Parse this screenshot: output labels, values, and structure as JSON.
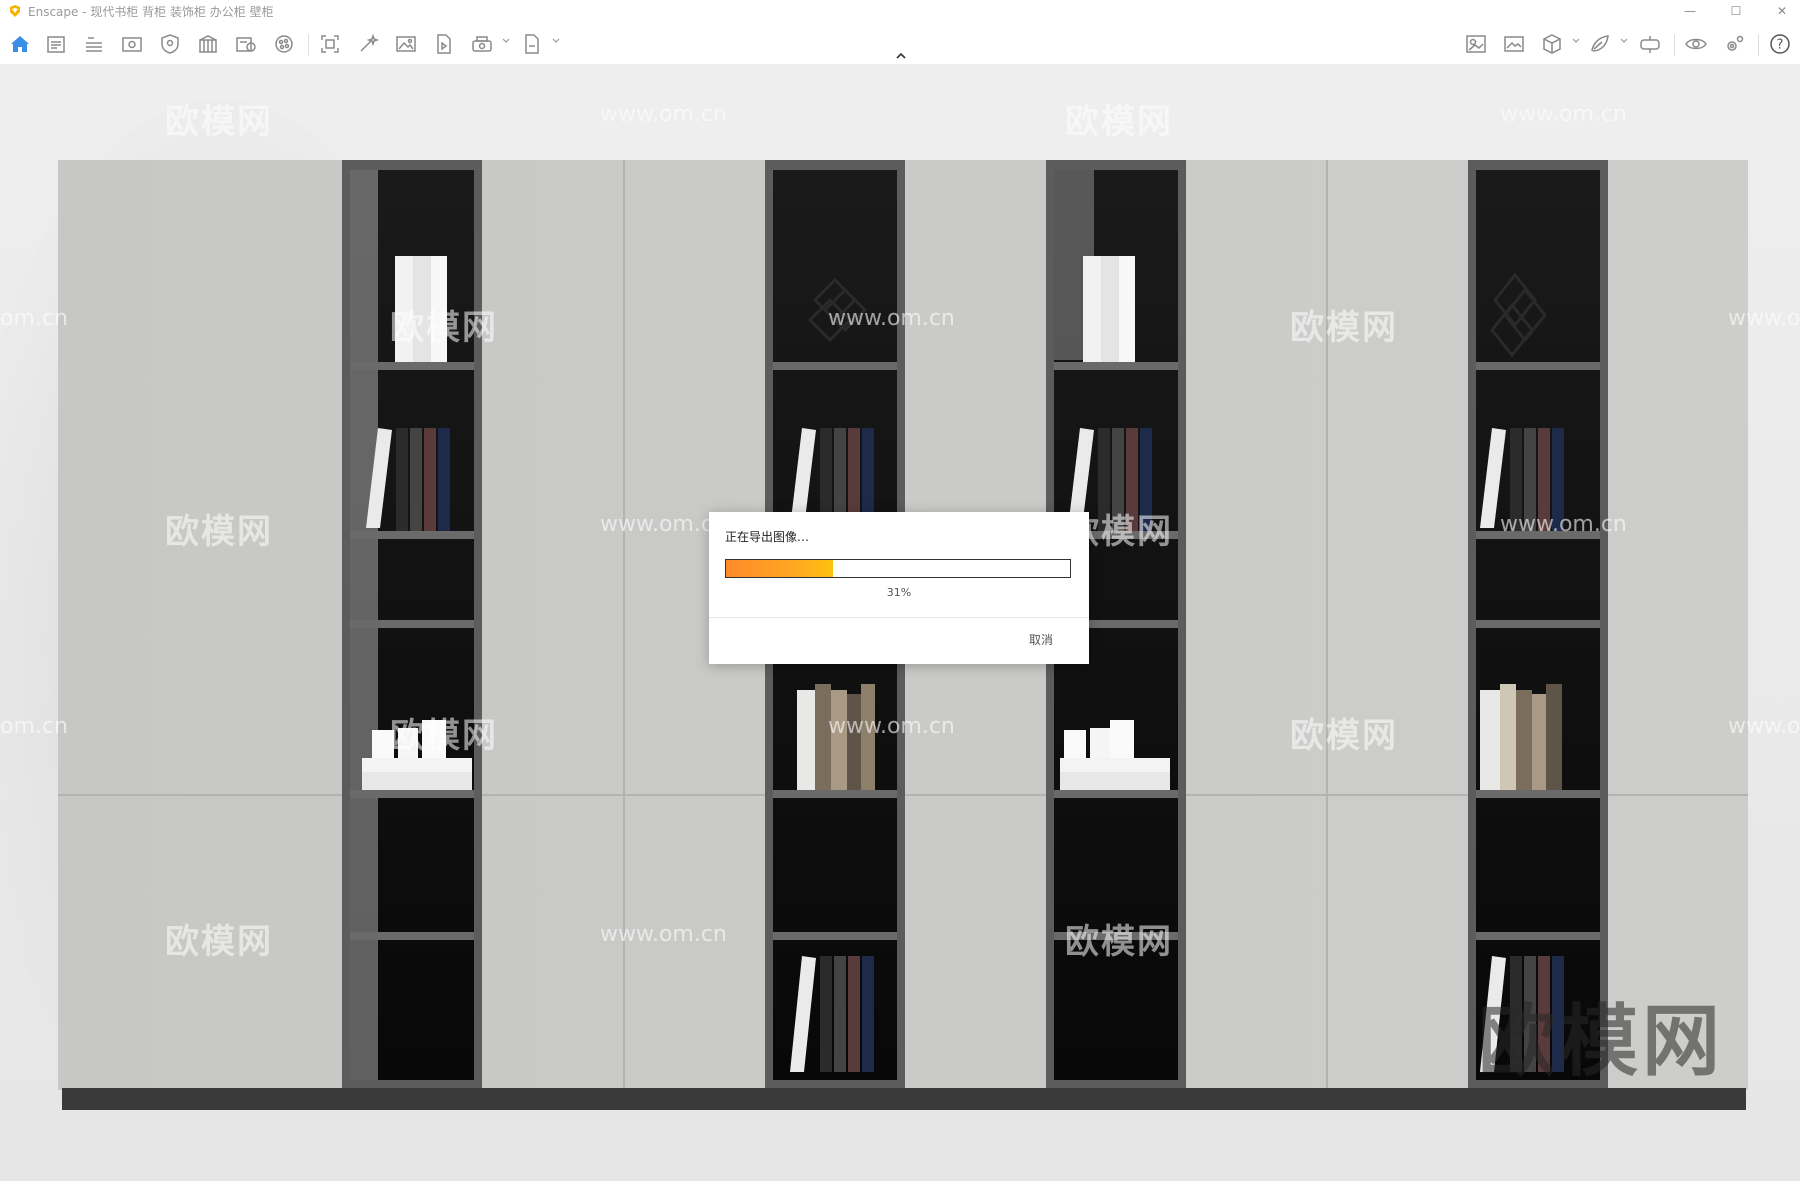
{
  "window": {
    "title": "Enscape - 现代书柜 背柜 装饰柜 办公柜 壁柜",
    "minimize": "—",
    "maximize": "☐",
    "close": "✕"
  },
  "toolbar": {
    "accent_color": "#3a8ee6",
    "icon_color": "#8a8a8a",
    "left_icons": [
      "home-icon",
      "project-icon",
      "bim-icon",
      "views-icon",
      "visual-settings-icon",
      "site-context-icon",
      "asset-library-icon",
      "material-editor-icon",
      "capture-icon",
      "batch-render-icon",
      "screenshot-icon",
      "video-editor-icon",
      "panorama-icon",
      "export-icon"
    ],
    "right_icons": [
      "sun-icon",
      "atmosphere-icon",
      "cube-icon",
      "vr-icon",
      "web-standalone-icon",
      "eye-icon",
      "settings-icon",
      "help-icon"
    ],
    "help_label": "?"
  },
  "viewport": {
    "watermark_cn": "欧模网",
    "watermark_url": "www.om.cn",
    "watermark_url_partial_left": "om.cn",
    "watermark_url_partial_right": "www.o",
    "big_watermark": "欧模网"
  },
  "dialog": {
    "title": "正在导出图像…",
    "progress_fraction": 0.31,
    "progress_label": "31%",
    "cancel_label": "取消"
  }
}
